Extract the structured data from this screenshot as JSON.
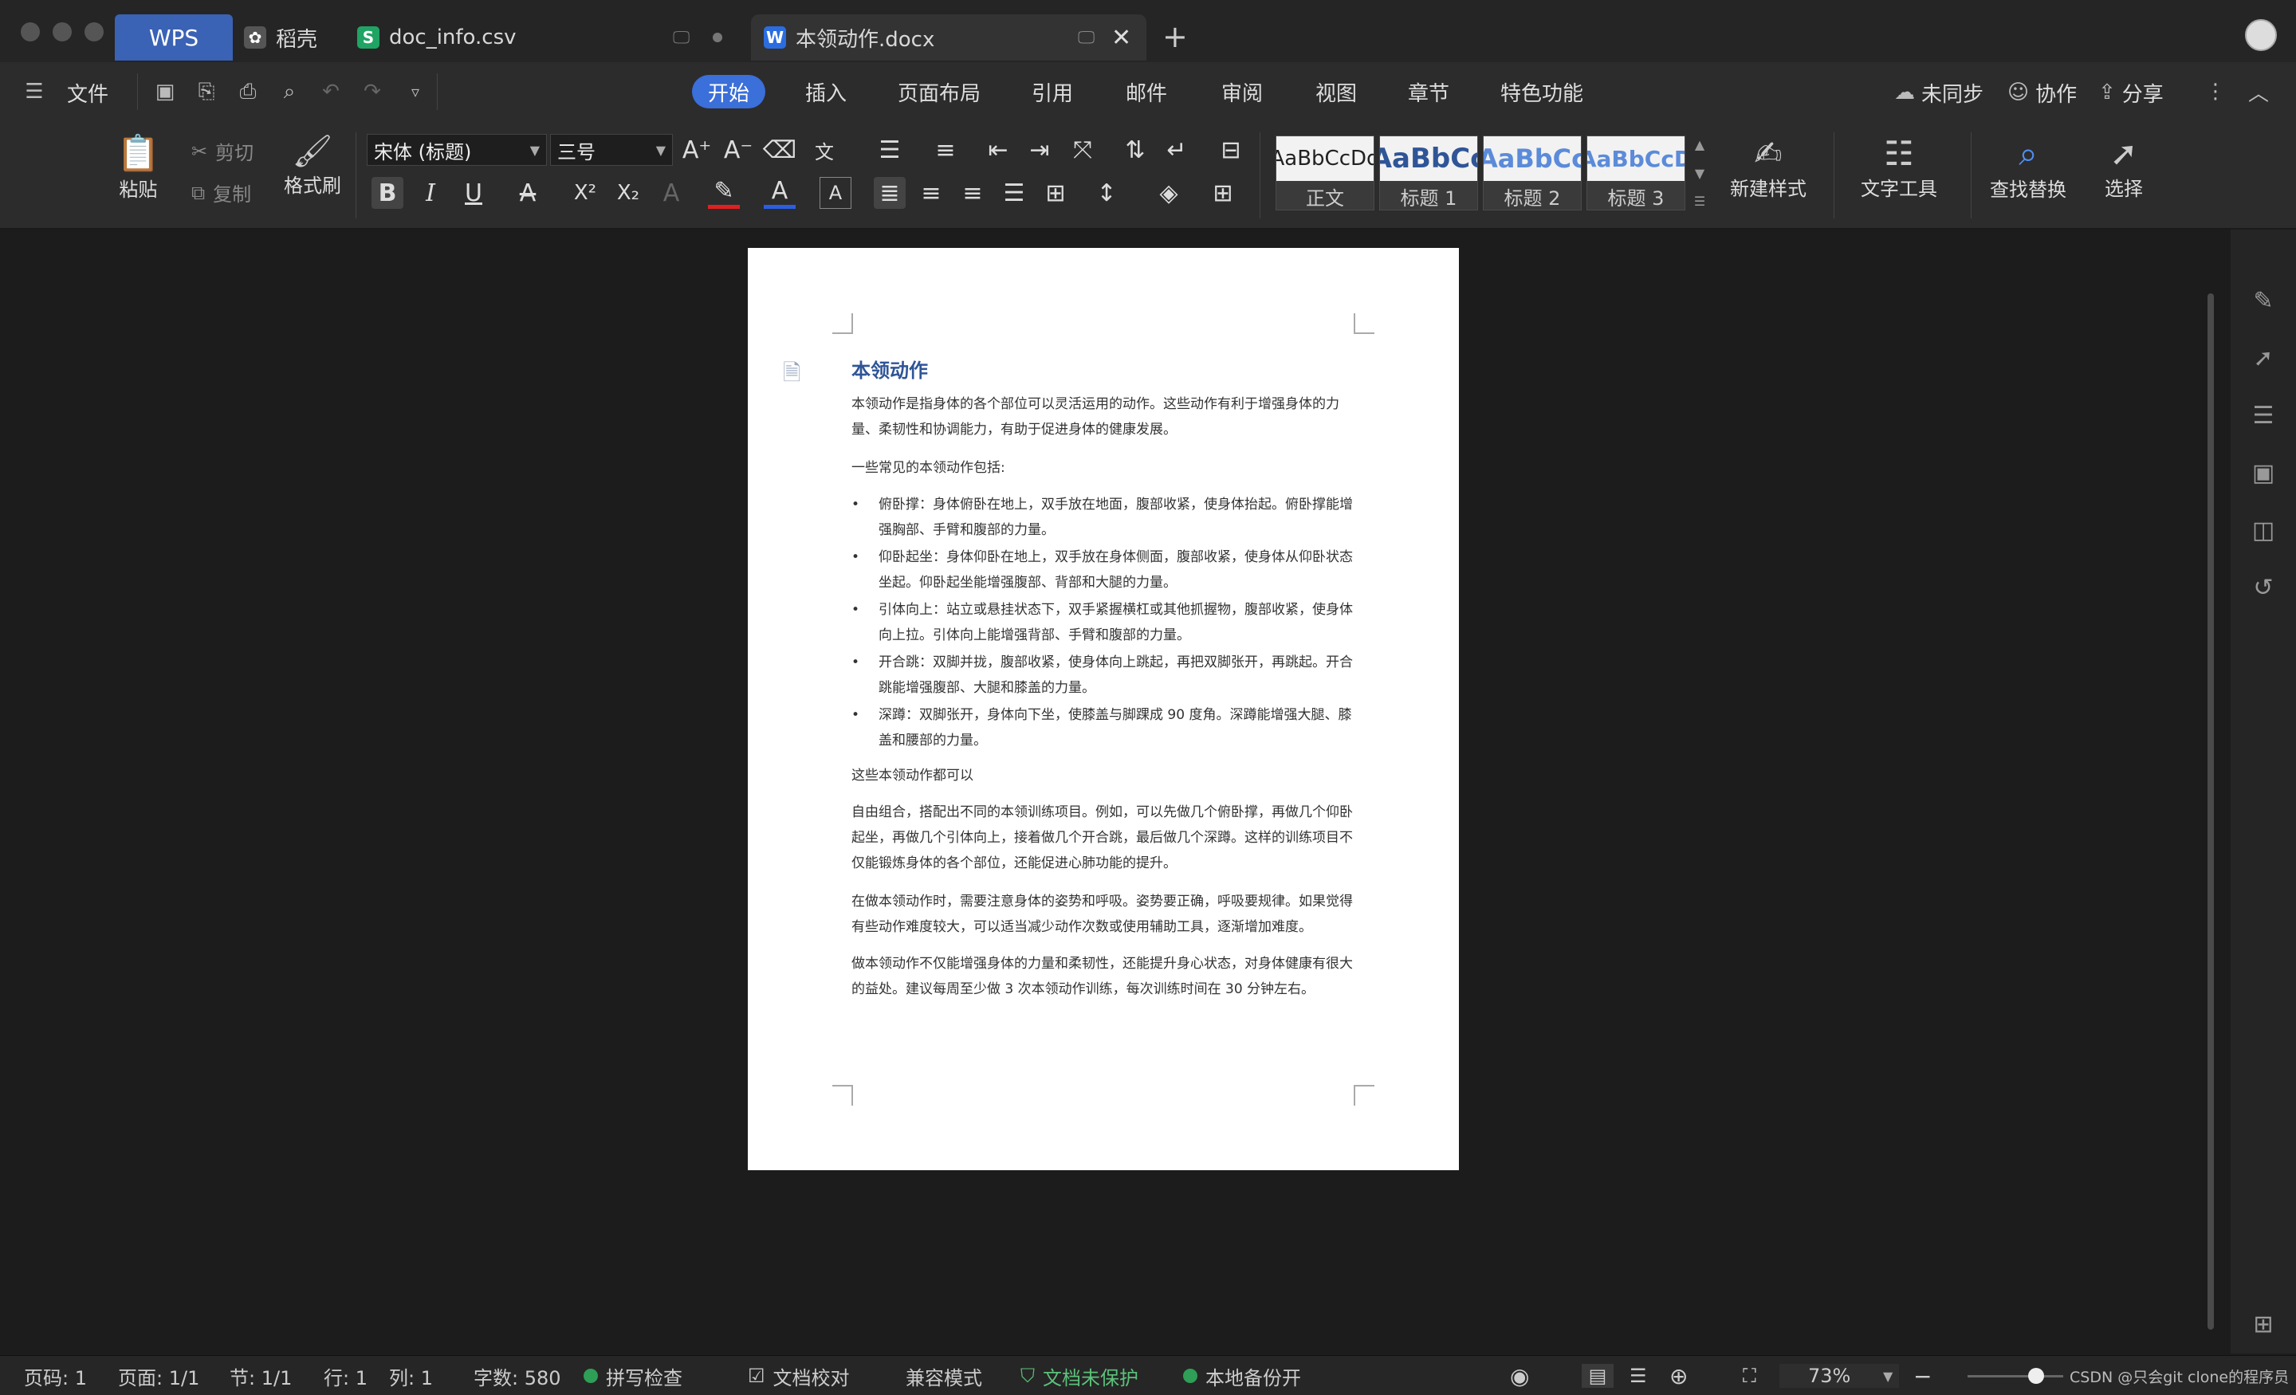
{
  "tabs": {
    "wps": "WPS",
    "daoke": "稻壳",
    "csv": "doc_info.csv",
    "doc": "本领动作.docx"
  },
  "menu": {
    "file": "文件",
    "tabs": [
      "开始",
      "插入",
      "页面布局",
      "引用",
      "邮件",
      "审阅",
      "视图",
      "章节",
      "特色功能"
    ],
    "unsynced": "未同步",
    "collab": "协作",
    "share": "分享"
  },
  "ribbon": {
    "paste": "粘贴",
    "cut": "剪切",
    "copy": "复制",
    "format_painter": "格式刷",
    "font_name": "宋体 (标题)",
    "font_size": "三号",
    "styles": [
      {
        "sample": "AaBbCcDd",
        "label": "正文"
      },
      {
        "sample": "AaBbCc",
        "label": "标题 1"
      },
      {
        "sample": "AaBbCc",
        "label": "标题 2"
      },
      {
        "sample": "AaBbCcD",
        "label": "标题 3"
      }
    ],
    "new_style": "新建样式",
    "text_tools": "文字工具",
    "find_replace": "查找替换",
    "select": "选择"
  },
  "document": {
    "title": "本领动作",
    "intro": "本领动作是指身体的各个部位可以灵活运用的动作。这些动作有利于增强身体的力量、柔韧性和协调能力，有助于促进身体的健康发展。",
    "list_intro": "一些常见的本领动作包括:",
    "items": [
      "俯卧撑：身体俯卧在地上，双手放在地面，腹部收紧，使身体抬起。俯卧撑能增强胸部、手臂和腹部的力量。",
      "仰卧起坐：身体仰卧在地上，双手放在身体侧面，腹部收紧，使身体从仰卧状态坐起。仰卧起坐能增强腹部、背部和大腿的力量。",
      "引体向上：站立或悬挂状态下，双手紧握横杠或其他抓握物，腹部收紧，使身体向上拉。引体向上能增强背部、手臂和腹部的力量。",
      "开合跳：双脚并拢，腹部收紧，使身体向上跳起，再把双脚张开，再跳起。开合跳能增强腹部、大腿和膝盖的力量。",
      "深蹲：双脚张开，身体向下坐，使膝盖与脚踝成 90 度角。深蹲能增强大腿、膝盖和腰部的力量。"
    ],
    "p1": "这些本领动作都可以",
    "p2": "自由组合，搭配出不同的本领训练项目。例如，可以先做几个俯卧撑，再做几个仰卧起坐，再做几个引体向上，接着做几个开合跳，最后做几个深蹲。这样的训练项目不仅能锻炼身体的各个部位，还能促进心肺功能的提升。",
    "p3": "在做本领动作时，需要注意身体的姿势和呼吸。姿势要正确，呼吸要规律。如果觉得有些动作难度较大，可以适当减少动作次数或使用辅助工具，逐渐增加难度。",
    "p4": "做本领动作不仅能增强身体的力量和柔韧性，还能提升身心状态，对身体健康有很大的益处。建议每周至少做 3 次本领动作训练，每次训练时间在 30 分钟左右。"
  },
  "status": {
    "page_code": "页码: 1",
    "page": "页面: 1/1",
    "section": "节: 1/1",
    "row": "行: 1",
    "col": "列: 1",
    "word_count": "字数: 580",
    "spell": "拼写检查",
    "proofread": "文档校对",
    "compat": "兼容模式",
    "unprotected": "文档未保护",
    "backup": "本地备份开",
    "zoom": "73%",
    "watermark": "CSDN @只会git clone的程序员"
  },
  "colors": {
    "accent": "#3b6fd9",
    "wps_tab": "#3a62b5",
    "heading": "#2f5597",
    "status_green": "#2f9e57"
  }
}
